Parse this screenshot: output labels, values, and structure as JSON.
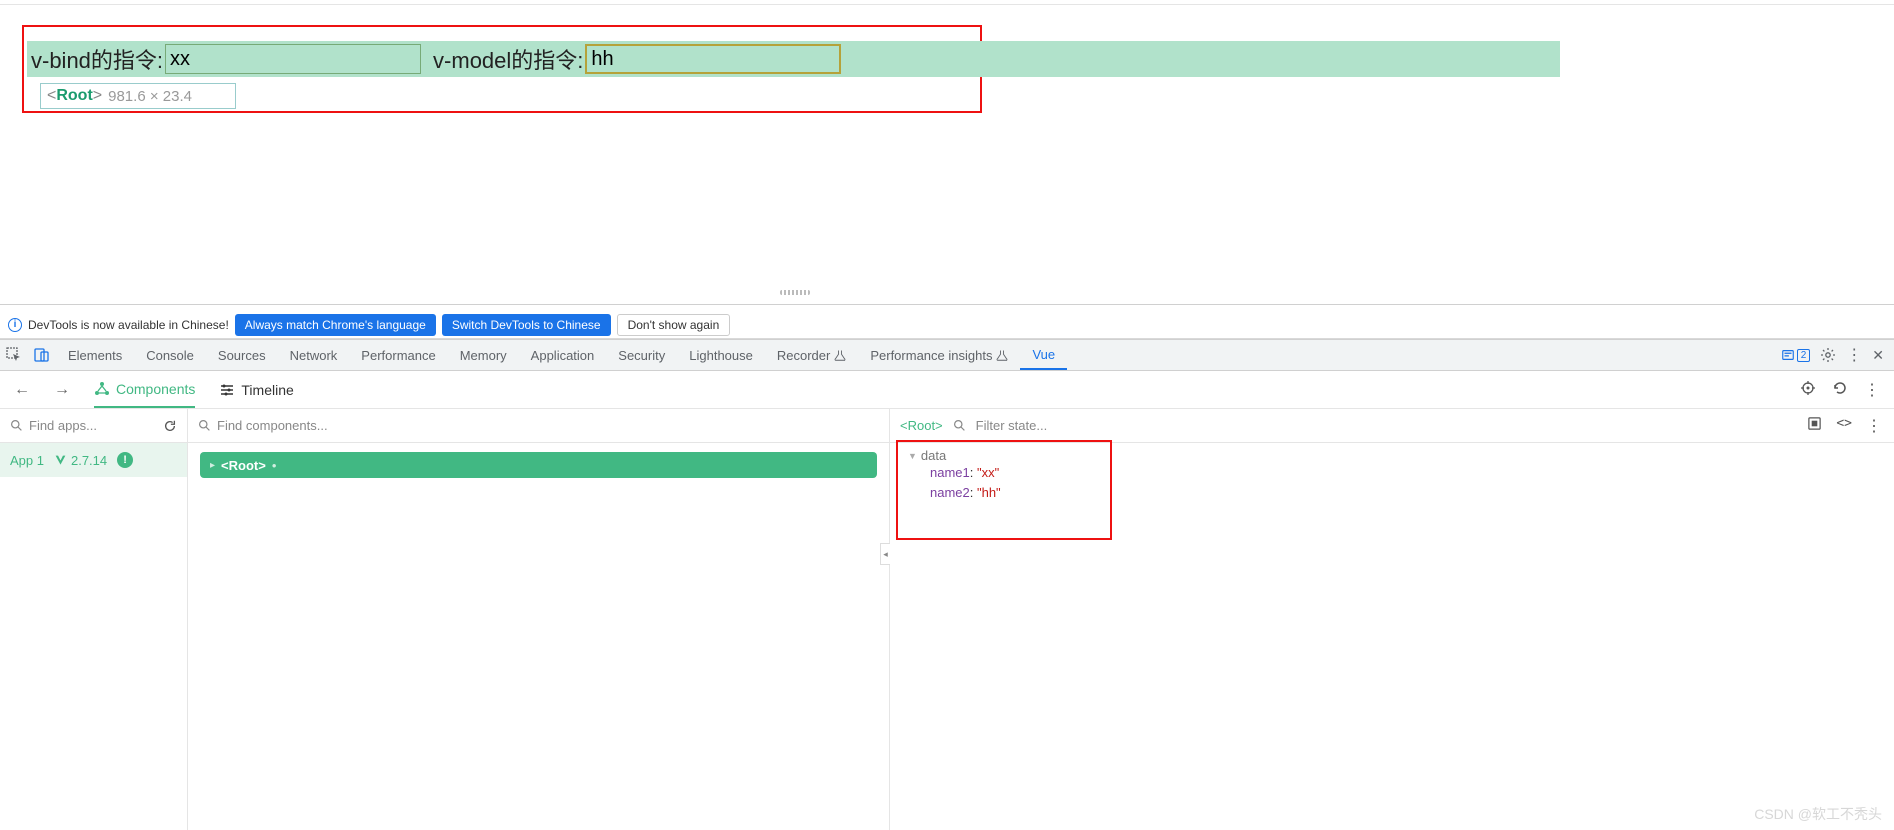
{
  "page": {
    "label_vbind": "v-bind的指令:",
    "input_vbind": "xx",
    "label_vmodel": "v-model的指令:",
    "input_vmodel": "hh",
    "root_name": "Root",
    "root_dims": "981.6 × 23.4"
  },
  "notice": {
    "text": "DevTools is now available in Chinese!",
    "btn_match": "Always match Chrome's language",
    "btn_switch": "Switch DevTools to Chinese",
    "btn_dont": "Don't show again"
  },
  "devtools_tabs": {
    "elements": "Elements",
    "console": "Console",
    "sources": "Sources",
    "network": "Network",
    "performance": "Performance",
    "memory": "Memory",
    "application": "Application",
    "security": "Security",
    "lighthouse": "Lighthouse",
    "recorder": "Recorder",
    "perf_insights": "Performance insights",
    "vue": "Vue",
    "issue_count": "2"
  },
  "vue_sub": {
    "components": "Components",
    "timeline": "Timeline"
  },
  "search": {
    "apps_placeholder": "Find apps...",
    "comp_placeholder": "Find components...",
    "crumb": "<Root>",
    "filter_placeholder": "Filter state..."
  },
  "apps": {
    "name": "App 1",
    "version": "2.7.14"
  },
  "tree": {
    "root": "<Root>"
  },
  "state": {
    "section": "data",
    "items": [
      {
        "key": "name1",
        "value": "\"xx\""
      },
      {
        "key": "name2",
        "value": "\"hh\""
      }
    ]
  },
  "watermark": "CSDN @软工不秃头"
}
